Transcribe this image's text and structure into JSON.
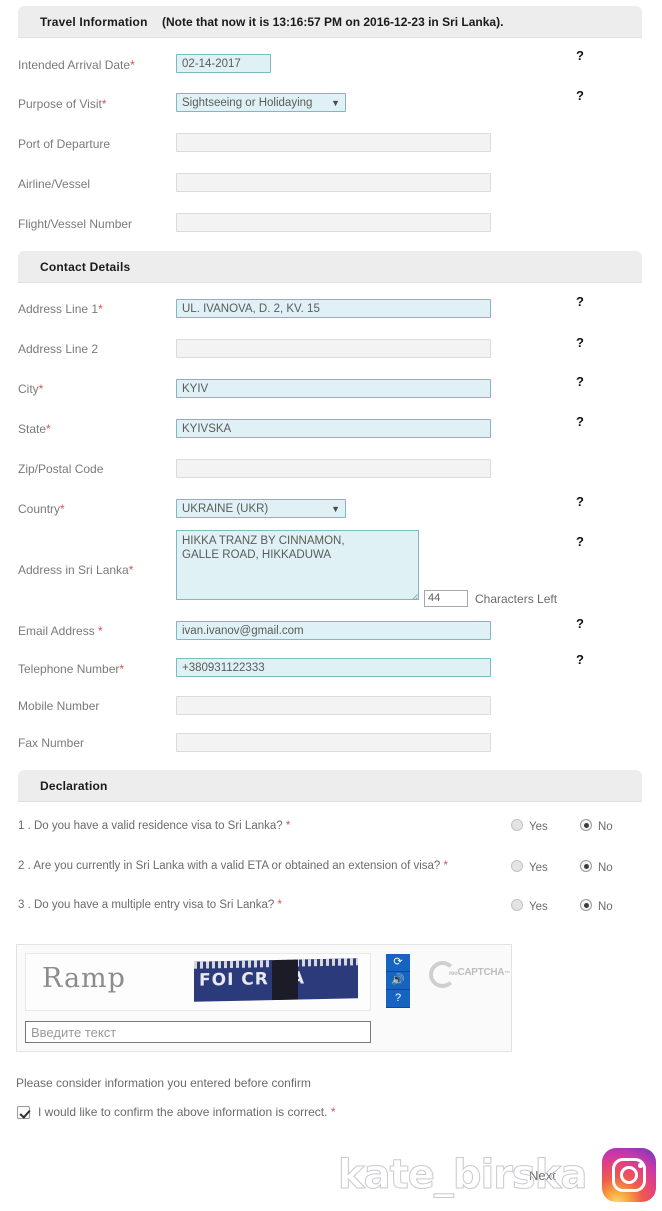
{
  "sections": {
    "travel": {
      "title": "Travel Information",
      "note": "(Note that now it is 13:16:57 PM on 2016-12-23 in Sri Lanka)."
    },
    "contact": {
      "title": "Contact Details",
      "note": ""
    },
    "declaration": {
      "title": "Declaration",
      "note": ""
    }
  },
  "travel_fields": [
    {
      "label": "Intended Arrival Date",
      "required": true,
      "value": "02-14-2017",
      "type": "date",
      "help": "?"
    },
    {
      "label": "Purpose of Visit",
      "required": true,
      "value": "Sightseeing or Holidaying",
      "type": "select",
      "help": "?"
    },
    {
      "label": "Port of Departure",
      "required": false,
      "value": "",
      "type": "text",
      "help": ""
    },
    {
      "label": "Airline/Vessel",
      "required": false,
      "value": "",
      "type": "text",
      "help": ""
    },
    {
      "label": "Flight/Vessel Number",
      "required": false,
      "value": "",
      "type": "text",
      "help": ""
    }
  ],
  "contact_fields": [
    {
      "label": "Address Line 1",
      "required": true,
      "value": "UL. IVANOVA, D. 2, KV. 15",
      "type": "text",
      "help": "?"
    },
    {
      "label": "Address Line 2",
      "required": false,
      "value": "",
      "type": "text",
      "help": "?"
    },
    {
      "label": "City",
      "required": true,
      "value": "KYIV",
      "type": "text",
      "help": "?"
    },
    {
      "label": "State",
      "required": true,
      "value": "KYIVSKA",
      "type": "text",
      "help": "?"
    },
    {
      "label": "Zip/Postal Code",
      "required": false,
      "value": "",
      "type": "text",
      "help": ""
    },
    {
      "label": "Country",
      "required": true,
      "value": "UKRAINE (UKR)",
      "type": "select",
      "help": "?"
    }
  ],
  "sri_lanka_address": {
    "label": "Address in Sri Lanka",
    "required": true,
    "value": "HIKKA TRANZ BY CINNAMON,\nGALLE ROAD, HIKKADUWA",
    "chars_left": "44",
    "chars_label": "Characters Left",
    "help": "?"
  },
  "contact_fields2": [
    {
      "label": "Email Address ",
      "required": true,
      "value": "ivan.ivanov@gmail.com",
      "type": "text",
      "help": "?"
    },
    {
      "label": "Telephone Number",
      "required": true,
      "value": "+380931122333",
      "type": "text",
      "help": "?"
    },
    {
      "label": "Mobile Number",
      "required": false,
      "value": "",
      "type": "text",
      "help": ""
    },
    {
      "label": "Fax Number",
      "required": false,
      "value": "",
      "type": "text",
      "help": ""
    }
  ],
  "declaration_questions": [
    {
      "text": "1 . Do you have a valid residence visa to Sri Lanka?",
      "required": true,
      "yes_label": "Yes",
      "no_label": "No",
      "answer": "No"
    },
    {
      "text": "2 . Are you currently in Sri Lanka with a valid ETA or obtained an extension of visa?",
      "required": true,
      "yes_label": "Yes",
      "no_label": "No",
      "answer": "No"
    },
    {
      "text": "3 . Do you have a multiple entry visa to Sri Lanka?",
      "required": true,
      "yes_label": "Yes",
      "no_label": "No",
      "answer": "No"
    }
  ],
  "captcha": {
    "word": "Ramp",
    "sign_text": "FOI CR  DA",
    "input_placeholder": "Введите текст",
    "input_value": "",
    "brand_prefix": "reo",
    "brand": "CAPTCHA",
    "brand_tm": "™",
    "refresh_icon": "refresh-icon",
    "audio_icon": "audio-icon",
    "help_icon": "help-icon"
  },
  "footer": {
    "note": "Please consider information you entered before confirm",
    "confirm_label": "I would like to confirm the above information is correct.",
    "confirm_required": true,
    "confirm_checked": true,
    "next_label": "Next"
  },
  "watermark": {
    "text": "kate_birska"
  },
  "colors": {
    "section_bar": "#ededed",
    "filled_field_bg": "#dff1f4",
    "filled_field_border": "#7cb9c2",
    "empty_field_bg": "#f3f3f3",
    "required_asterisk": "#d9534f",
    "captcha_button": "#1565c0"
  }
}
